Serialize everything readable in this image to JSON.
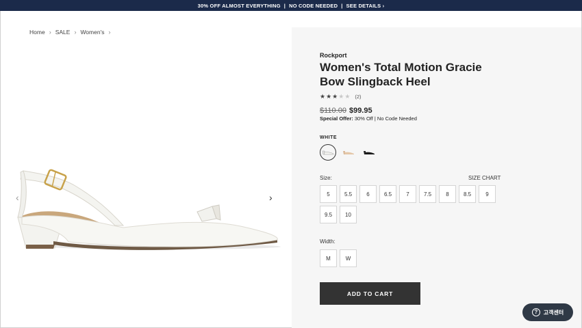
{
  "promo": {
    "text": "30% OFF ALMOST EVERYTHING",
    "sep1": "|",
    "code": "NO CODE NEEDED",
    "sep2": "|",
    "link": "SEE DETAILS ›"
  },
  "breadcrumb": {
    "items": [
      "Home",
      "SALE",
      "Women's"
    ],
    "chevron": "›"
  },
  "gallery": {
    "prev_arrow": "‹",
    "next_arrow": "›"
  },
  "product": {
    "brand": "Rockport",
    "title": "Women's Total Motion Gracie Bow Slingback Heel",
    "rating": 3,
    "rating_max": 5,
    "rating_count": "(2)",
    "old_price": "$110.00",
    "new_price": "$99.95",
    "offer_label": "Special Offer:",
    "offer_text": " 30% Off | No Code Needed",
    "color_label": "WHITE",
    "size_label": "Size:",
    "size_chart": "SIZE CHART",
    "sizes": [
      "5",
      "5.5",
      "6",
      "6.5",
      "7",
      "7.5",
      "8",
      "8.5",
      "9",
      "9.5",
      "10"
    ],
    "width_label": "Width:",
    "widths": [
      "M",
      "W"
    ],
    "add_to_cart": "ADD TO CART"
  },
  "help": {
    "icon_glyph": "?",
    "label": "고객센터"
  },
  "colors": {
    "promo_bg": "#1b2a4a",
    "details_bg": "#f6f6f6",
    "button_dark": "#333333"
  }
}
